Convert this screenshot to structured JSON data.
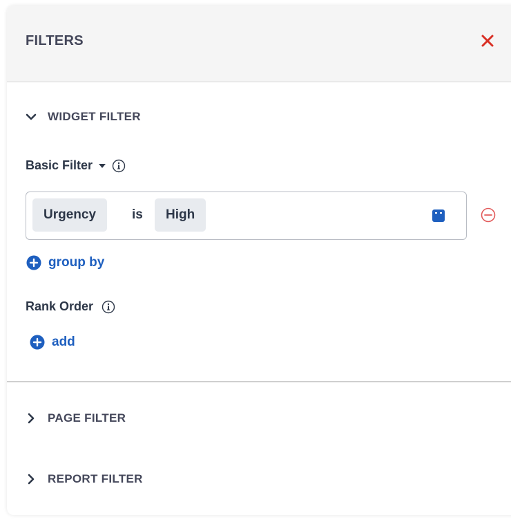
{
  "header": {
    "title": "FILTERS",
    "close_icon": "close-icon",
    "close_color": "#d93025"
  },
  "widget_filter": {
    "label": "WIDGET FILTER",
    "expanded": true,
    "basic_filter": {
      "label": "Basic Filter",
      "condition": {
        "field": "Urgency",
        "operator": "is",
        "value": "High"
      }
    },
    "group_by_label": "group by",
    "rank_order": {
      "label": "Rank Order",
      "add_label": "add"
    }
  },
  "page_filter": {
    "label": "PAGE FILTER",
    "expanded": false
  },
  "report_filter": {
    "label": "REPORT FILTER",
    "expanded": false
  },
  "colors": {
    "accent": "#1e5fbf",
    "remove": "#e25b5b",
    "header_bg": "#f5f5f5"
  }
}
